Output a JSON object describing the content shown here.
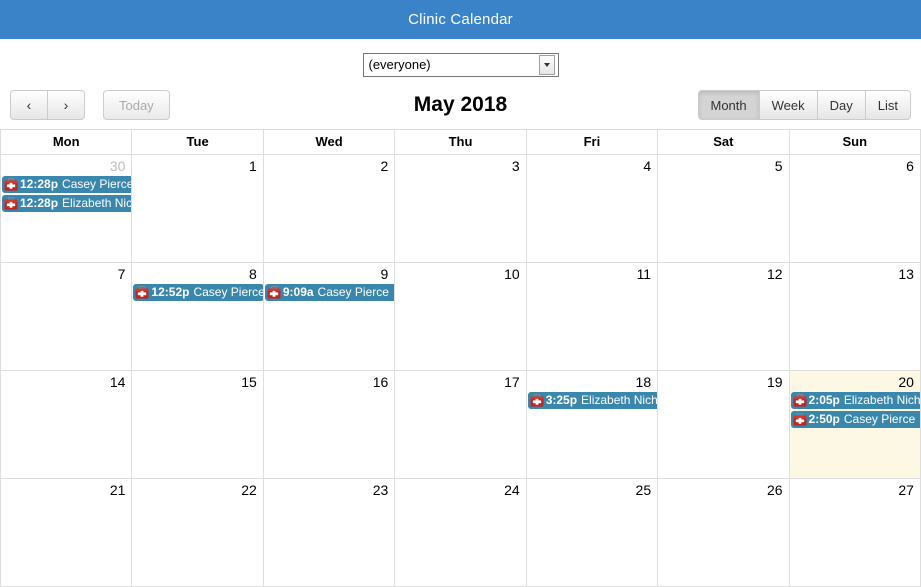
{
  "window": {
    "title": "Clinic Calendar",
    "titlebar_color": "#3b83c9"
  },
  "filter": {
    "name": "person-filter",
    "selected": "(everyone)",
    "options": [
      "(everyone)"
    ]
  },
  "toolbar": {
    "prev_label": "‹",
    "next_label": "›",
    "today_label": "Today",
    "today_disabled": true,
    "title": "May 2018",
    "views": [
      {
        "label": "Month",
        "active": true
      },
      {
        "label": "Week",
        "active": false
      },
      {
        "label": "Day",
        "active": false
      },
      {
        "label": "List",
        "active": false
      }
    ]
  },
  "calendar": {
    "day_headers": [
      "Mon",
      "Tue",
      "Wed",
      "Thu",
      "Fri",
      "Sat",
      "Sun"
    ],
    "event_color": "#3a87ad",
    "today_cell_color": "#fcf8e3",
    "icon": "first-aid-kit-icon",
    "weeks": [
      {
        "days": [
          {
            "number": "30",
            "other_month": true,
            "today": false,
            "events": [
              {
                "time": "12:28p",
                "title": "Casey Pierce"
              },
              {
                "time": "12:28p",
                "title": "Elizabeth Nichols"
              }
            ]
          },
          {
            "number": "1",
            "other_month": false,
            "today": false,
            "events": []
          },
          {
            "number": "2",
            "other_month": false,
            "today": false,
            "events": []
          },
          {
            "number": "3",
            "other_month": false,
            "today": false,
            "events": []
          },
          {
            "number": "4",
            "other_month": false,
            "today": false,
            "events": []
          },
          {
            "number": "5",
            "other_month": false,
            "today": false,
            "events": []
          },
          {
            "number": "6",
            "other_month": false,
            "today": false,
            "events": []
          }
        ]
      },
      {
        "days": [
          {
            "number": "7",
            "other_month": false,
            "today": false,
            "events": []
          },
          {
            "number": "8",
            "other_month": false,
            "today": false,
            "events": [
              {
                "time": "12:52p",
                "title": "Casey Pierce"
              }
            ]
          },
          {
            "number": "9",
            "other_month": false,
            "today": false,
            "events": [
              {
                "time": "9:09a",
                "title": "Casey Pierce"
              }
            ]
          },
          {
            "number": "10",
            "other_month": false,
            "today": false,
            "events": []
          },
          {
            "number": "11",
            "other_month": false,
            "today": false,
            "events": []
          },
          {
            "number": "12",
            "other_month": false,
            "today": false,
            "events": []
          },
          {
            "number": "13",
            "other_month": false,
            "today": false,
            "events": []
          }
        ]
      },
      {
        "days": [
          {
            "number": "14",
            "other_month": false,
            "today": false,
            "events": []
          },
          {
            "number": "15",
            "other_month": false,
            "today": false,
            "events": []
          },
          {
            "number": "16",
            "other_month": false,
            "today": false,
            "events": []
          },
          {
            "number": "17",
            "other_month": false,
            "today": false,
            "events": []
          },
          {
            "number": "18",
            "other_month": false,
            "today": false,
            "events": [
              {
                "time": "3:25p",
                "title": "Elizabeth Nichols"
              }
            ]
          },
          {
            "number": "19",
            "other_month": false,
            "today": false,
            "events": []
          },
          {
            "number": "20",
            "other_month": false,
            "today": true,
            "events": [
              {
                "time": "2:05p",
                "title": "Elizabeth Nichols"
              },
              {
                "time": "2:50p",
                "title": "Casey Pierce"
              }
            ]
          }
        ]
      },
      {
        "days": [
          {
            "number": "21",
            "other_month": false,
            "today": false,
            "events": []
          },
          {
            "number": "22",
            "other_month": false,
            "today": false,
            "events": []
          },
          {
            "number": "23",
            "other_month": false,
            "today": false,
            "events": []
          },
          {
            "number": "24",
            "other_month": false,
            "today": false,
            "events": []
          },
          {
            "number": "25",
            "other_month": false,
            "today": false,
            "events": []
          },
          {
            "number": "26",
            "other_month": false,
            "today": false,
            "events": []
          },
          {
            "number": "27",
            "other_month": false,
            "today": false,
            "events": []
          }
        ]
      }
    ]
  }
}
